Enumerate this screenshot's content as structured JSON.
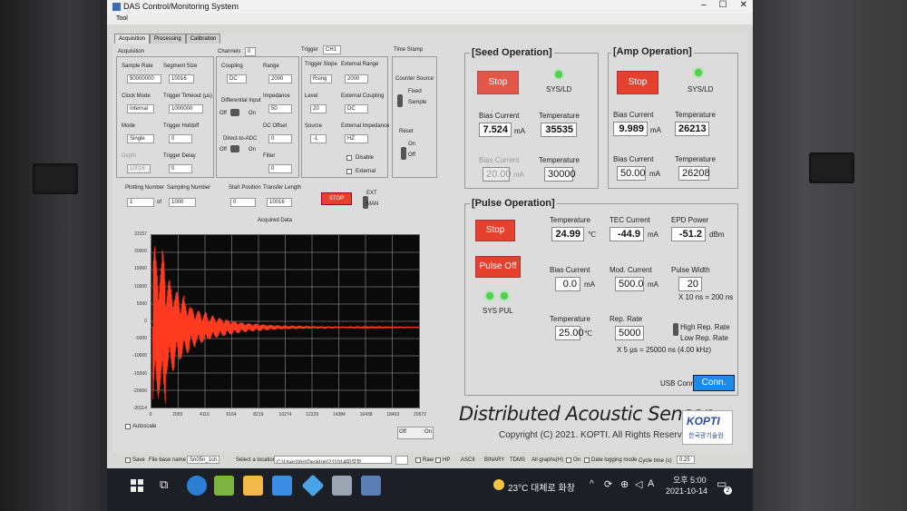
{
  "window": {
    "title": "DAS Control/Monitoring System",
    "menu": "Tool"
  },
  "tabs": [
    "Acquisition",
    "Processing",
    "Calibration"
  ],
  "acq": {
    "section": "Acquisition",
    "sample_rate_lbl": "Sample Rate",
    "sample_rate": "50000000",
    "segment_size_lbl": "Segment Size",
    "segment_size": "10016",
    "clock_mode_lbl": "Clock Mode",
    "clock_mode": "Internal",
    "trigger_timeout_lbl": "Trigger Timeout (μs)",
    "trigger_timeout": "1000000",
    "mode_lbl": "Mode",
    "mode": "Single",
    "trigger_holdoff_lbl": "Trigger Holdoff",
    "trigger_holdoff": "0",
    "depth_lbl": "Depth",
    "depth": "10016",
    "trigger_delay_lbl": "Trigger Delay",
    "trigger_delay": "0"
  },
  "chan": {
    "channels_lbl": "Channels",
    "channels": "0",
    "coupling_lbl": "Coupling",
    "coupling": "DC",
    "range_lbl": "Range",
    "range": "2000",
    "diff_lbl": "Differential Input",
    "off": "Off",
    "on": "On",
    "impedance_lbl": "Impedance",
    "impedance": "50",
    "dc_offset_lbl": "DC Offset",
    "dc_offset": "0",
    "direct_lbl": "Direct-to-ADC",
    "filter_lbl": "Filter",
    "filter": "0"
  },
  "trig": {
    "trigger_lbl": "Trigger",
    "trigger": "CH1",
    "slope_lbl": "Trigger Slope",
    "slope": "Rsing",
    "ext_range_lbl": "External Range",
    "ext_range": "2000",
    "level_lbl": "Level",
    "level": "20",
    "ext_coupling_lbl": "External Coupling",
    "ext_coupling": "DC",
    "source_lbl": "Source",
    "source": "-1",
    "ext_impedance_lbl": "External Impedance",
    "ext_impedance": "HZ",
    "disable_lbl": "Disable",
    "external_lbl": "External"
  },
  "ts": {
    "title": "Time Stamp",
    "counter_source": "Counter Source",
    "fixed": "Fixed",
    "sample": "Sample",
    "reset": "Reset",
    "on": "On",
    "off": "Off"
  },
  "plotting": {
    "plot_number_lbl": "Plotting Number",
    "plot_number": "1",
    "of": "of",
    "sampling_number_lbl": "Sampling Number",
    "sampling_number": "1000",
    "start_pos_lbl": "Start Position",
    "start_pos": "0",
    "transfer_len_lbl": "Transfer Length",
    "transfer_len": "10016",
    "stop": "STOP",
    "ext": "EXT",
    "man": "MAN"
  },
  "graph": {
    "title": "Acquired Data",
    "y_ticks": [
      "23157",
      "20000",
      "15000",
      "10000",
      "5000",
      "0",
      "-5000",
      "-10000",
      "-15000",
      "-20000",
      "-20114"
    ],
    "x_ticks": [
      "0",
      "2055",
      "4110",
      "6164",
      "8219",
      "10274",
      "12329",
      "14384",
      "16438",
      "18493",
      "20572"
    ],
    "autoscale": "Autoscale",
    "off": "Off",
    "on": "On"
  },
  "chart_data": {
    "type": "line",
    "title": "Acquired Data",
    "xlabel": "",
    "ylabel": "",
    "xlim": [
      0,
      20572
    ],
    "ylim": [
      -20114,
      23157
    ],
    "grid": true,
    "series": [
      {
        "values": [
          0,
          20500,
          -18000,
          16500,
          -19500,
          12000,
          -11000,
          9000,
          -8000,
          6500,
          -5000,
          4200,
          -3800,
          3000,
          -2600,
          2200,
          -1800,
          1500,
          -1200,
          1000,
          -900,
          700,
          -600,
          500,
          -450,
          400,
          -350,
          300,
          -280,
          250,
          -220,
          200,
          -180,
          160,
          -150,
          140,
          -120,
          110,
          -100,
          90
        ]
      }
    ],
    "color": "#ff3a1f"
  },
  "seed": {
    "title": "[Seed Operation]",
    "stop": "Stop",
    "led_lbl": "SYS/LD",
    "bias_lbl": "Bias Current",
    "bias": "7.524",
    "bias_unit": "mA",
    "temp_lbl": "Temperature",
    "temp": "35535",
    "bias_set_lbl": "Bias Current",
    "bias_set": "20.00",
    "bias_set_unit": "mA",
    "temp_set_lbl": "Temperature",
    "temp_set": "30000"
  },
  "amp": {
    "title": "[Amp Operation]",
    "stop": "Stop",
    "led_lbl": "SYS/LD",
    "bias_lbl": "Bias Current",
    "bias": "9.989",
    "bias_unit": "mA",
    "temp_lbl": "Temperature",
    "temp": "26213",
    "bias_set_lbl": "Bias Current",
    "bias_set": "50.00",
    "bias_set_unit": "mA",
    "temp_set_lbl": "Temperature",
    "temp_set": "26208"
  },
  "pulse": {
    "title": "[Pulse Operation]",
    "stop": "Stop",
    "pulse_off": "Pulse Off",
    "sys": "SYS",
    "pul": "PUL",
    "temp_lbl": "Temperature",
    "temp": "24.99",
    "temp_unit": "℃",
    "tec_lbl": "TEC Current",
    "tec": "-44.9",
    "tec_unit": "mA",
    "epd_lbl": "EPD Power",
    "epd": "-51.2",
    "epd_unit": "dBm",
    "bias_lbl": "Bias Current",
    "bias": "0.0",
    "bias_unit": "mA",
    "mod_lbl": "Mod. Current",
    "mod": "500.0",
    "mod_unit": "mA",
    "pw_lbl": "Pulse Width",
    "pw": "20",
    "pw_calc": "X 10 ns = 200 ns",
    "temp_set_lbl": "Temperature",
    "temp_set": "25.00",
    "temp_set_unit": "℃",
    "rep_lbl": "Rep. Rate",
    "rep": "5000",
    "high_rep": "High Rep. Rate",
    "low_rep": "Low Rep. Rate",
    "rep_calc": "X 5 μs = 25000 ns (4.00 kHz)",
    "usb_lbl": "USB Conn.",
    "conn": "Conn."
  },
  "brand": {
    "title": "Distributed Acoustic Sensor",
    "copyright": "Copyright (C) 2021. KOPTI. All Rights Reserved.",
    "logo_top": "KOPTI",
    "logo_bottom": "한국광기술원"
  },
  "status": {
    "save": "Save",
    "file_base": "File base name",
    "file_base_val": "Sn05n_1ch",
    "select_loc": "Select a location",
    "location": "C:\\Users\\hn\\Desktop\\211014미설정",
    "raw": "Raw",
    "hp": "HP",
    "ascii": "ASCII",
    "binary": "BINARY",
    "tdms": "TDMS",
    "all_graphs": "All graphs(H)",
    "on": "On",
    "date_logging": "Date logging mode",
    "cycle_lbl": "Cycle time (s)",
    "cycle": "0.25"
  },
  "taskbar": {
    "weather": "23°C 대체로 화창",
    "ampm": "오후 5:00",
    "date": "2021-10-14",
    "lang": "A",
    "notif": "2"
  }
}
